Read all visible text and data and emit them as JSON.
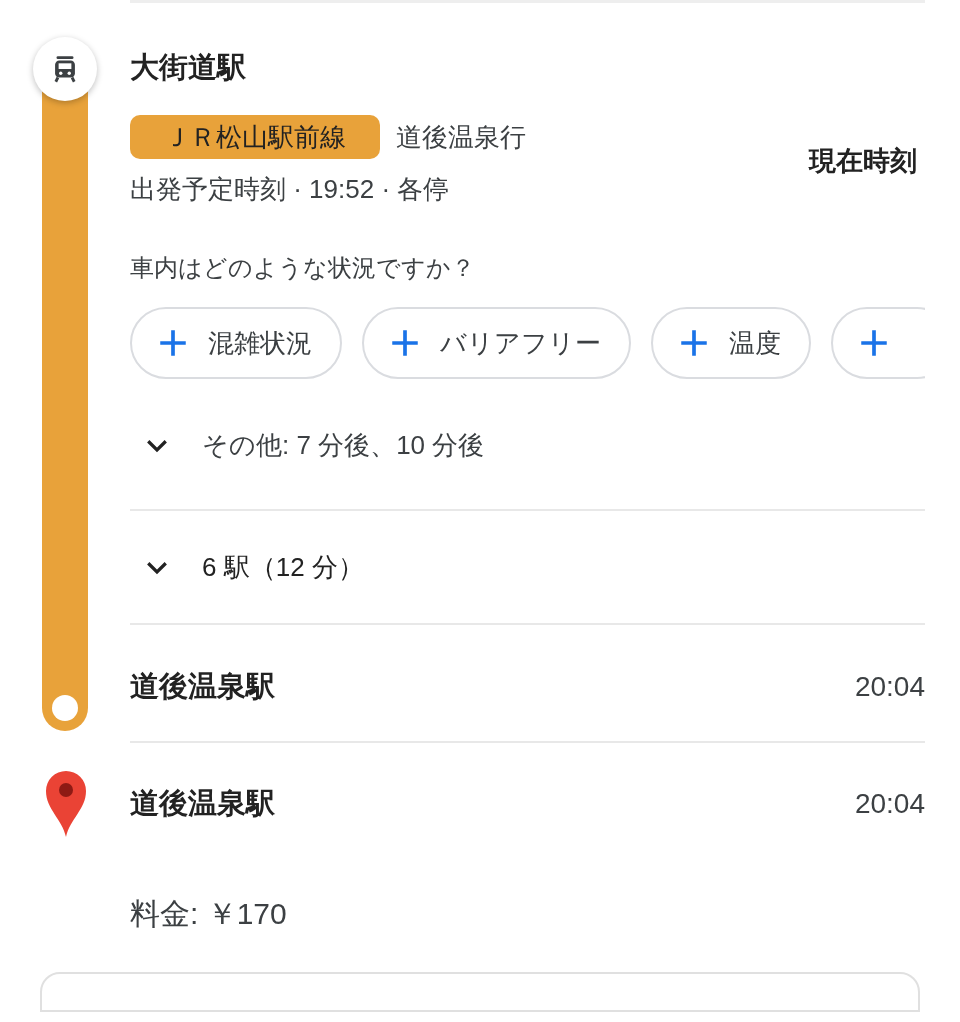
{
  "departure": {
    "station": "大街道駅",
    "line": {
      "name": "ＪＲ松山駅前線",
      "color": "#e8a23a"
    },
    "headsign": "道後温泉行",
    "realtime_label": "現在時刻",
    "schedule": "出発予定時刻 · 19:52 · 各停"
  },
  "crowd_question": "車内はどのような状況ですか？",
  "chips": [
    {
      "kind": "labeled",
      "label": "混雑状況"
    },
    {
      "kind": "labeled",
      "label": "バリアフリー"
    },
    {
      "kind": "labeled",
      "label": "温度"
    },
    {
      "kind": "icon_only"
    }
  ],
  "other_departures": {
    "text": "その他: 7 分後、10 分後",
    "expanded": false
  },
  "stops": {
    "text": "6 駅（12 分）",
    "expanded": false
  },
  "arrival": {
    "station": "道後温泉駅",
    "time": "20:04"
  },
  "destination": {
    "station": "道後温泉駅",
    "time": "20:04"
  },
  "fare": "料金: ￥170"
}
